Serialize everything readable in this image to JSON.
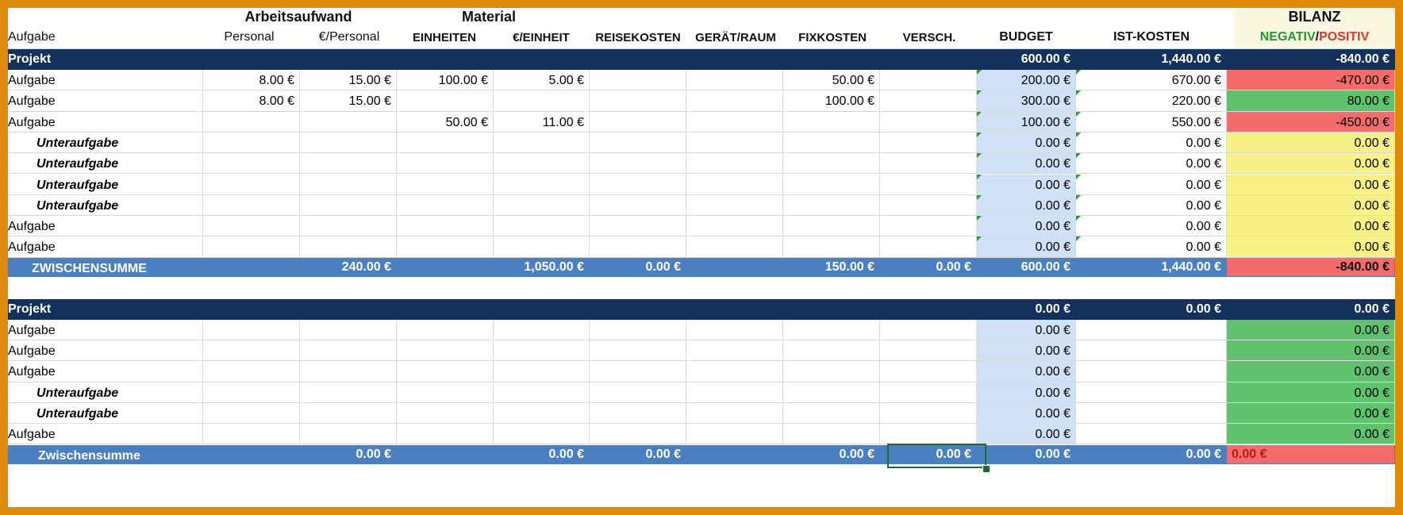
{
  "header": {
    "group_labor": "Arbeitsaufwand",
    "group_material": "Material",
    "col_task": "Aufgabe",
    "col_personal": "Personal",
    "col_eur_personal": "€/Personal",
    "col_units": "EINHEITEN",
    "col_eur_unit": "€/EINHEIT",
    "col_travel": "REISEKOSTEN",
    "col_equipment": "GERÄT/RAUM",
    "col_fixed": "FIXKOSTEN",
    "col_misc": "VERSCH.",
    "col_budget": "BUDGET",
    "col_actual": "IST-KOSTEN",
    "col_balance": "BILANZ",
    "balance_negative": "NEGATIV",
    "balance_slash": "/",
    "balance_positive": "POSITIV"
  },
  "colors": {
    "negative_label": "#1f9a2e",
    "positive_label": "#e0342f",
    "project_band": "#12325b",
    "subtotal_band": "#4a80c2",
    "budget_column": "#cfe0f7",
    "balance_red": "#f36b6b",
    "balance_green": "#60c16f",
    "balance_yellow": "#f8f187",
    "frame": "#e08a0b"
  },
  "project1": {
    "label": "Projekt",
    "budget": "600.00 €",
    "actual": "1,440.00 €",
    "balance": "-840.00 €",
    "rows": [
      {
        "task": "Aufgabe",
        "personal": "8.00 €",
        "eur_personal": "15.00 €",
        "units": "100.00 €",
        "eur_unit": "5.00 €",
        "travel": "",
        "equipment": "",
        "fixed": "50.00 €",
        "misc": "",
        "budget": "200.00 €",
        "actual": "670.00 €",
        "balance": "-470.00 €",
        "status": "neg"
      },
      {
        "task": "Aufgabe",
        "personal": "8.00 €",
        "eur_personal": "15.00 €",
        "units": "",
        "eur_unit": "",
        "travel": "",
        "equipment": "",
        "fixed": "100.00 €",
        "misc": "",
        "budget": "300.00 €",
        "actual": "220.00 €",
        "balance": "80.00 €",
        "status": "pos"
      },
      {
        "task": "Aufgabe",
        "personal": "",
        "eur_personal": "",
        "units": "50.00 €",
        "eur_unit": "11.00 €",
        "travel": "",
        "equipment": "",
        "fixed": "",
        "misc": "",
        "budget": "100.00 €",
        "actual": "550.00 €",
        "balance": "-450.00 €",
        "status": "neg"
      },
      {
        "task": "Unteraufgabe",
        "sub": true,
        "personal": "",
        "eur_personal": "",
        "units": "",
        "eur_unit": "",
        "travel": "",
        "equipment": "",
        "fixed": "",
        "misc": "",
        "budget": "0.00 €",
        "actual": "0.00 €",
        "balance": "0.00 €",
        "status": "neu"
      },
      {
        "task": "Unteraufgabe",
        "sub": true,
        "personal": "",
        "eur_personal": "",
        "units": "",
        "eur_unit": "",
        "travel": "",
        "equipment": "",
        "fixed": "",
        "misc": "",
        "budget": "0.00 €",
        "actual": "0.00 €",
        "balance": "0.00 €",
        "status": "neu"
      },
      {
        "task": "Unteraufgabe",
        "sub": true,
        "personal": "",
        "eur_personal": "",
        "units": "",
        "eur_unit": "",
        "travel": "",
        "equipment": "",
        "fixed": "",
        "misc": "",
        "budget": "0.00 €",
        "actual": "0.00 €",
        "balance": "0.00 €",
        "status": "neu"
      },
      {
        "task": "Unteraufgabe",
        "sub": true,
        "personal": "",
        "eur_personal": "",
        "units": "",
        "eur_unit": "",
        "travel": "",
        "equipment": "",
        "fixed": "",
        "misc": "",
        "budget": "0.00 €",
        "actual": "0.00 €",
        "balance": "0.00 €",
        "status": "neu"
      },
      {
        "task": "Aufgabe",
        "personal": "",
        "eur_personal": "",
        "units": "",
        "eur_unit": "",
        "travel": "",
        "equipment": "",
        "fixed": "",
        "misc": "",
        "budget": "0.00 €",
        "actual": "0.00 €",
        "balance": "0.00 €",
        "status": "neu"
      },
      {
        "task": "Aufgabe",
        "personal": "",
        "eur_personal": "",
        "units": "",
        "eur_unit": "",
        "travel": "",
        "equipment": "",
        "fixed": "",
        "misc": "",
        "budget": "0.00 €",
        "actual": "0.00 €",
        "balance": "0.00 €",
        "status": "neu"
      }
    ],
    "subtotal": {
      "label": "ZWISCHENSUMME",
      "eur_personal": "240.00 €",
      "eur_unit": "1,050.00 €",
      "travel": "0.00 €",
      "fixed": "150.00 €",
      "misc": "0.00 €",
      "budget": "600.00 €",
      "actual": "1,440.00 €",
      "balance": "-840.00 €"
    }
  },
  "project2": {
    "label": "Projekt",
    "budget": "0.00 €",
    "actual": "0.00 €",
    "balance": "0.00 €",
    "rows": [
      {
        "task": "Aufgabe",
        "budget": "0.00 €",
        "balance": "0.00 €"
      },
      {
        "task": "Aufgabe",
        "budget": "0.00 €",
        "balance": "0.00 €"
      },
      {
        "task": "Aufgabe",
        "budget": "0.00 €",
        "balance": "0.00 €"
      },
      {
        "task": "Unteraufgabe",
        "sub": true,
        "budget": "0.00 €",
        "balance": "0.00 €"
      },
      {
        "task": "Unteraufgabe",
        "sub": true,
        "budget": "0.00 €",
        "balance": "0.00 €"
      },
      {
        "task": "Aufgabe",
        "budget": "0.00 €",
        "balance": "0.00 €"
      }
    ],
    "subtotal": {
      "label": "Zwischensumme",
      "eur_personal": "0.00 €",
      "eur_unit": "0.00 €",
      "travel": "0.00 €",
      "fixed": "0.00 €",
      "misc": "0.00 €",
      "budget": "0.00 €",
      "actual": "0.00 €",
      "balance": "0.00 €"
    }
  }
}
